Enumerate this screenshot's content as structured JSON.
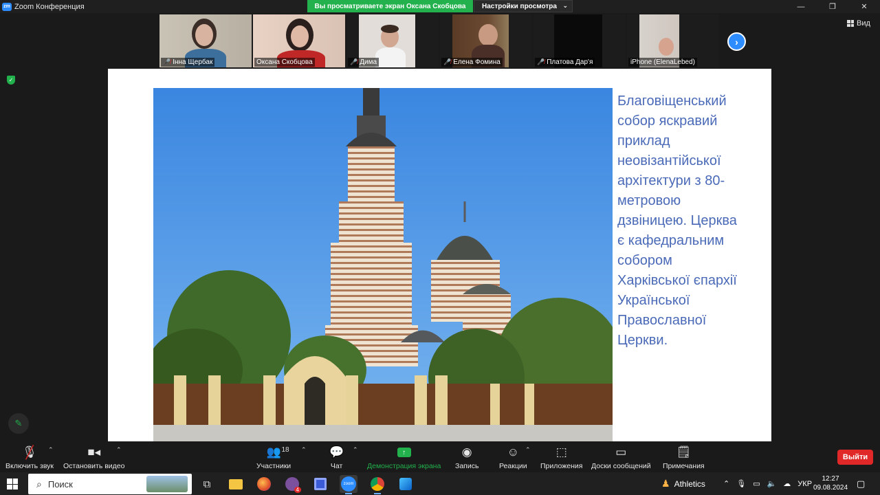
{
  "titlebar": {
    "app_title": "Zoom Конференция",
    "share_banner": "Вы просматриваете экран Оксана Скобцова",
    "view_options": "Настройки просмотра"
  },
  "participants": [
    {
      "name": "Інна Щербак",
      "muted": true
    },
    {
      "name": "Оксана Скобцова",
      "muted": false
    },
    {
      "name": "Дима",
      "muted": true
    },
    {
      "name": "Елена Фомина",
      "muted": true
    },
    {
      "name": "Платова Дар'я",
      "muted": true
    },
    {
      "name": "iPhone (ElenaLebed)",
      "muted": false
    }
  ],
  "view_button": "Вид",
  "slide": {
    "text": "Благовіщенський\nсобор  яскравий\nприклад\nнеовізантійської\nархітектури з 80-\nметровою\nдзвіницею. Церква\nє кафедральним\nсобором\nХарківської єпархії\nУкраїнської\nПравославної\nЦеркви."
  },
  "toolbar": {
    "audio": "Включить звук",
    "video": "Остановить видео",
    "participants": "Участники",
    "participants_count": "18",
    "chat": "Чат",
    "share": "Демонстрация экрана",
    "record": "Запись",
    "reactions": "Реакции",
    "apps": "Приложения",
    "whiteboards": "Доски сообщений",
    "notes": "Примечания",
    "leave": "Выйти"
  },
  "taskbar": {
    "search_placeholder": "Поиск",
    "weather_label": "Athletics",
    "language": "УКР",
    "time": "12:27",
    "date": "09.08.2024",
    "mail_badge": "4"
  },
  "colors": {
    "accent": "#2d8cff",
    "share_green": "#22b14c",
    "leave_red": "#e02828",
    "slide_text": "#4a6ab8"
  }
}
